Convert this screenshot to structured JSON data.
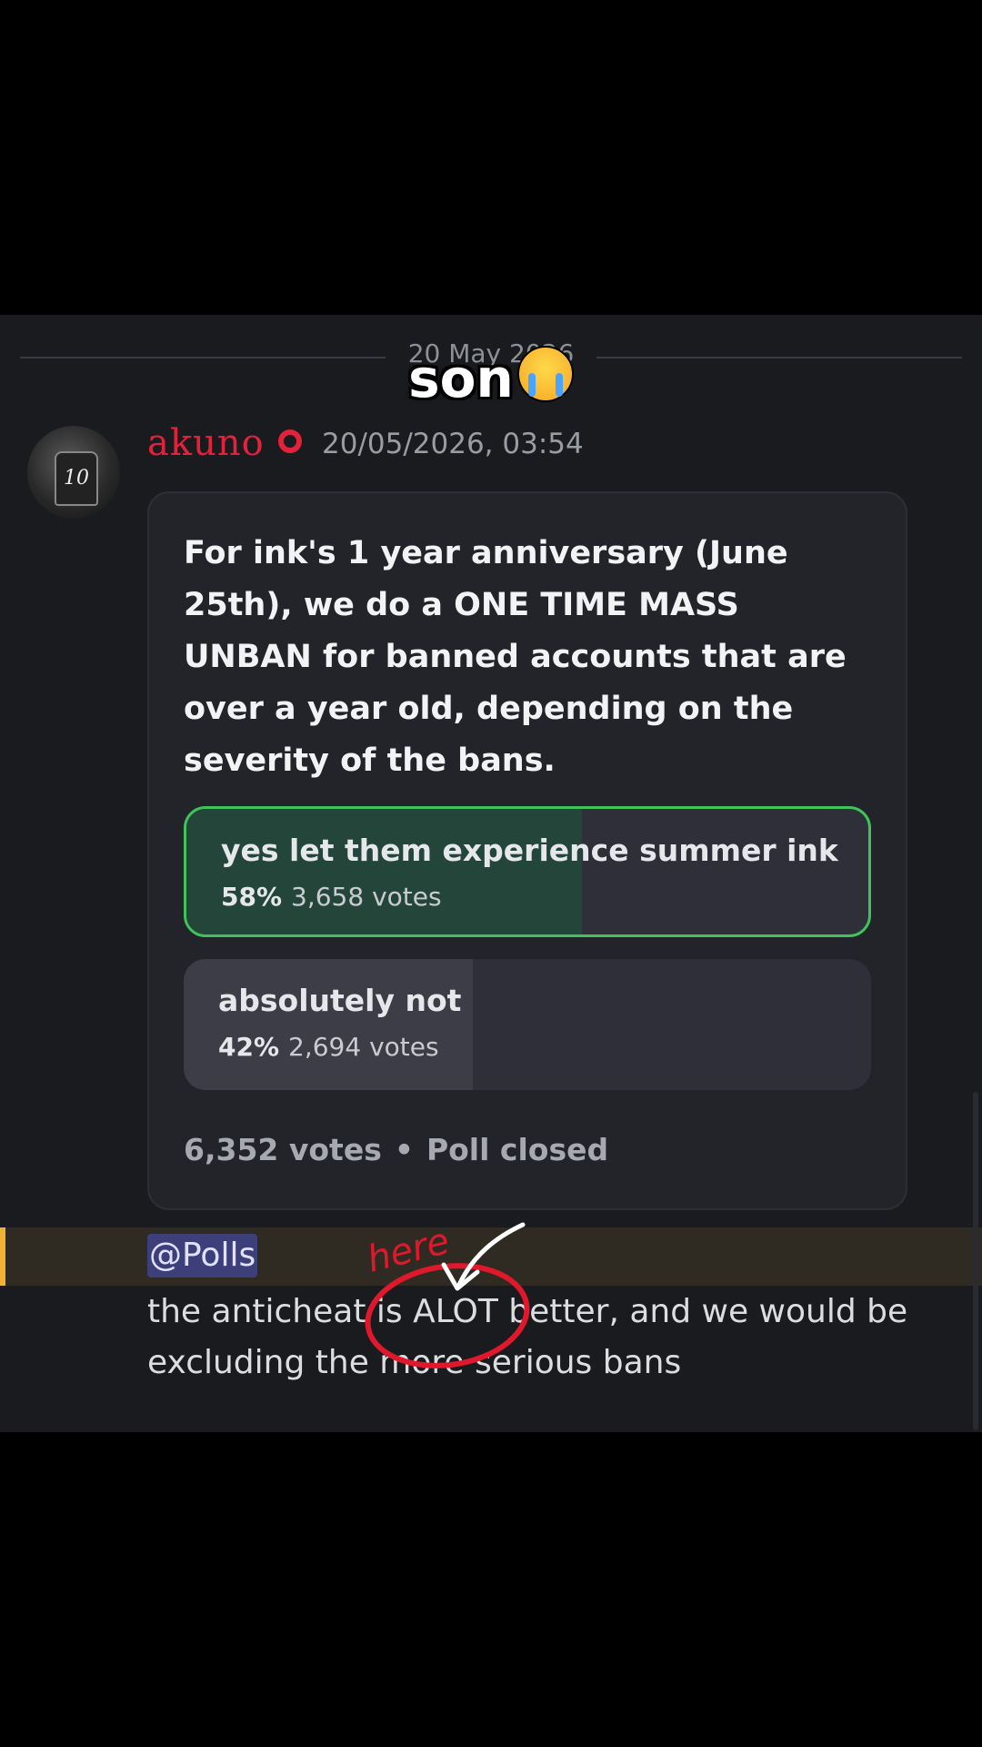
{
  "caption": "son",
  "date_divider": "20 May 2026",
  "message": {
    "username": "akuno",
    "timestamp": "20/05/2026, 03:54"
  },
  "poll": {
    "question": "For ink's 1 year anniversary (June 25th), we do a ONE TIME MASS UNBAN for banned accounts that are over a year old, depending on the severity of the bans.",
    "options": [
      {
        "label": "yes let them experience summer ink",
        "percent": "58%",
        "votes": "3,658 votes",
        "fraction": 0.58,
        "winner": true
      },
      {
        "label": "absolutely not",
        "percent": "42%",
        "votes": "2,694 votes",
        "fraction": 0.42,
        "winner": false
      }
    ],
    "total_votes": "6,352 votes",
    "status": "Poll closed",
    "separator": "•"
  },
  "reply": {
    "mention": "@Polls",
    "text": "the anticheat is ALOT better, and we would be excluding the more serious bans"
  },
  "annotation": {
    "label": "here",
    "color": "#e0182c"
  },
  "colors": {
    "username": "#e2223a",
    "winner_border": "#3ec45a",
    "winner_fill": "#24463a",
    "loser_fill": "#3c3d47",
    "mention_bar": "#f0b232"
  }
}
